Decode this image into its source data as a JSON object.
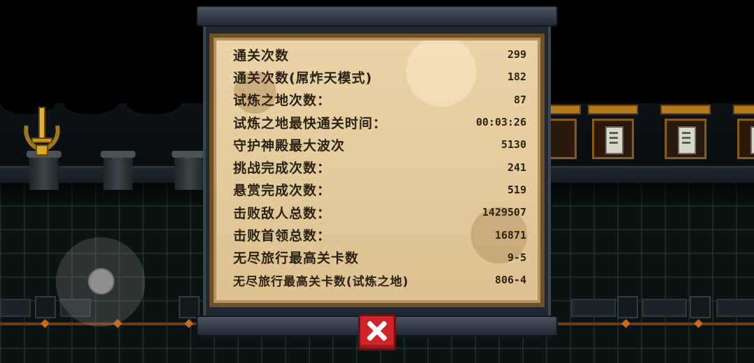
{
  "stats_panel": {
    "rows": [
      {
        "label": "通关次数",
        "value": "299"
      },
      {
        "label": "通关次数(屌炸天模式)",
        "value": "182"
      },
      {
        "label": "试炼之地次数：",
        "value": "87"
      },
      {
        "label": "试炼之地最快通关时间：",
        "value": "00:03:26"
      },
      {
        "label": "守护神殿最大波次",
        "value": "5130"
      },
      {
        "label": "挑战完成次数：",
        "value": "241"
      },
      {
        "label": "悬赏完成次数：",
        "value": "519"
      },
      {
        "label": "击败敌人总数：",
        "value": "1429507"
      },
      {
        "label": "击败首领总数：",
        "value": "16871"
      },
      {
        "label": "无尽旅行最高关卡数",
        "value": "9-5"
      },
      {
        "label": "无尽旅行最高关卡数(试炼之地)",
        "value": "806-4"
      }
    ]
  },
  "icons": {
    "close": "close-x-icon",
    "trophy": "sword-trophy-icon",
    "joystick": "virtual-joystick"
  },
  "colors": {
    "parchment": "#e2c99a",
    "text": "#2b2216",
    "close_button": "#d0242b"
  }
}
